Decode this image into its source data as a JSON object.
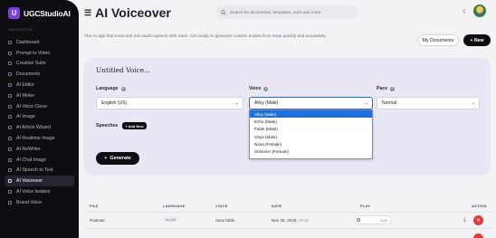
{
  "sidebar": {
    "brand": "UGCStudioAI",
    "caption": "NAVIGATION",
    "items": [
      {
        "label": "Dashboard"
      },
      {
        "label": "Prompt to Video"
      },
      {
        "label": "Creative Suite"
      },
      {
        "label": "Documents"
      },
      {
        "label": "AI Editor"
      },
      {
        "label": "AI Writer"
      },
      {
        "label": "AI Voice Clone"
      },
      {
        "label": "AI Image"
      },
      {
        "label": "AI Article Wizard"
      },
      {
        "label": "AI Realtime Image"
      },
      {
        "label": "AI ReWriter"
      },
      {
        "label": "AI Chat Image"
      },
      {
        "label": "AI Speech to Text"
      },
      {
        "label": "AI Voiceover",
        "active": true
      },
      {
        "label": "AI Voice Isolator"
      },
      {
        "label": "Brand Voice"
      }
    ]
  },
  "header": {
    "title": "AI Voiceover",
    "search_placeholder": "Search for documents, templates, tools and more"
  },
  "page": {
    "description": "The AI app that turns text into audio speech with ease. Get ready to generate custom audios from texts quickly and accurately.",
    "my_documents_label": "My Documents",
    "new_label": "+ New"
  },
  "form": {
    "title": "Untitled Voice...",
    "language_label": "Language",
    "language_value": "English (US)",
    "voice_label": "Voice",
    "voice_value": "Alloy (Male)",
    "pace_label": "Pace",
    "pace_value": "Normal",
    "speeches_label": "Speeches",
    "add_new_label": "+ Add New",
    "generate_label": "Generate"
  },
  "voice_options": [
    "Alloy (Male)",
    "Echo (Male)",
    "Fable (Male)",
    "Onyx (Male)",
    "Nova (Female)",
    "Shimmer (Female)"
  ],
  "table": {
    "headers": {
      "file": "FILE",
      "language": "LANGUAGE",
      "voice": "VOICE",
      "date": "DATE",
      "play": "PLAY",
      "action": "ACTION"
    },
    "rows": [
      {
        "file": "Podcast",
        "language": "en-US",
        "voice": "nova fable",
        "date": "Nov 28, 2025,",
        "time": "00:11",
        "duration": "0:00"
      }
    ]
  },
  "colors": {
    "accent": "#7b3fe4",
    "dark": "#0d0d12",
    "selected": "#1e6fd9",
    "danger": "#e53935",
    "card": "#ebe6f4"
  }
}
